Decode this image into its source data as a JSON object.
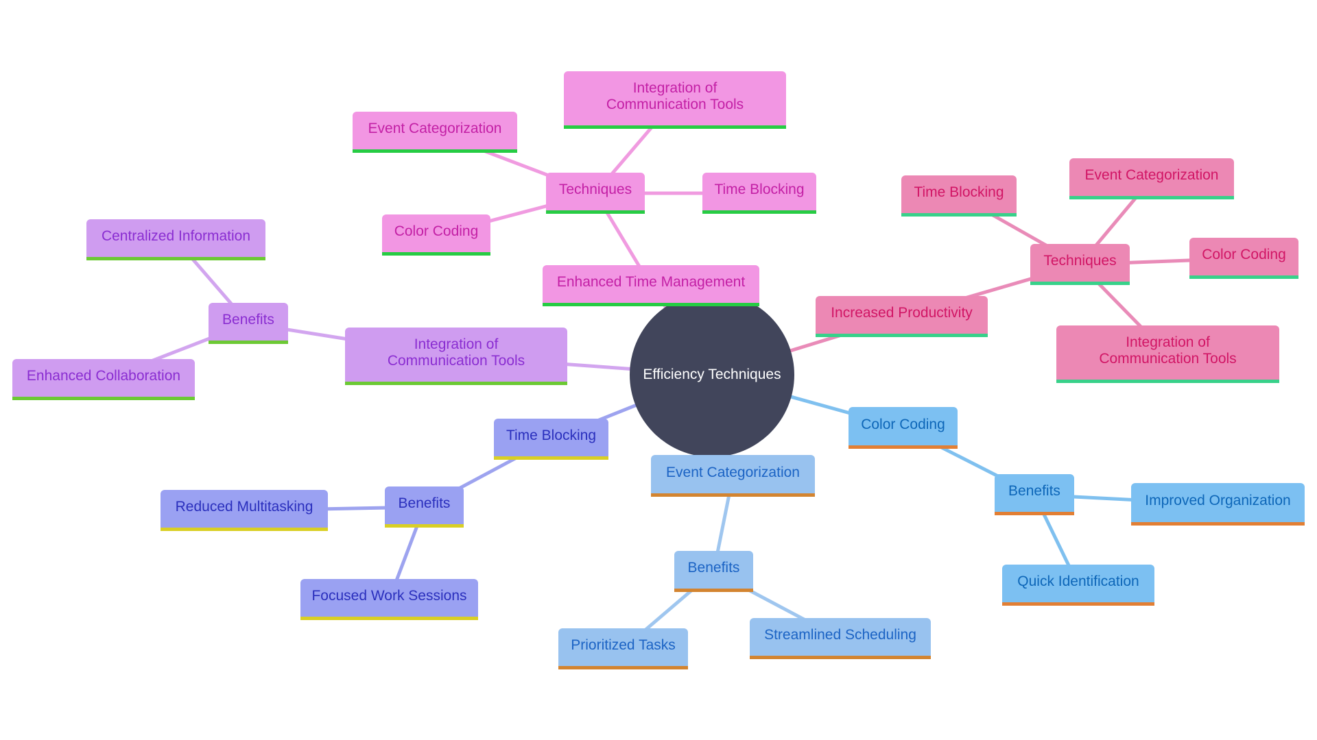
{
  "diagram": {
    "type": "mindmap",
    "root": {
      "label": "Efficiency Techniques",
      "color": "#41455b"
    },
    "branch_colors": {
      "enhanced_time_management": {
        "fill": "#f296e3",
        "text": "#c31fa5",
        "accent": "#26cc43",
        "edge": "#f09be0"
      },
      "increased_productivity": {
        "fill": "#ec88b4",
        "text": "#d11565",
        "accent": "#38d18a",
        "edge": "#e98bb8"
      },
      "integration_of_communication_tools": {
        "fill": "#cf9cf0",
        "text": "#8a2dd1",
        "accent": "#6cc934",
        "edge": "#d2a5ef"
      },
      "time_blocking": {
        "fill": "#9aa1f2",
        "text": "#2a2fbd",
        "accent": "#d9cf25",
        "edge": "#9da3ef"
      },
      "event_categorization": {
        "fill": "#98c2ef",
        "text": "#1b63c4",
        "accent": "#d38430",
        "edge": "#9fc6ef"
      },
      "color_coding": {
        "fill": "#7cc0f2",
        "text": "#0d66b8",
        "accent": "#e27f34",
        "edge": "#7fc0ef"
      }
    },
    "nodes": {
      "etm": "Enhanced Time Management",
      "etm_tech": "Techniques",
      "etm_tech_ec": "Event Categorization",
      "etm_tech_ict": "Integration of Communication Tools",
      "etm_tech_tb": "Time Blocking",
      "etm_tech_cc": "Color Coding",
      "ip": "Increased Productivity",
      "ip_tech": "Techniques",
      "ip_tech_tb": "Time Blocking",
      "ip_tech_ec": "Event Categorization",
      "ip_tech_cc": "Color Coding",
      "ip_tech_ict": "Integration of Communication Tools",
      "ict": "Integration of Communication Tools",
      "ict_ben": "Benefits",
      "ict_ben_ci": "Centralized Information",
      "ict_ben_ec": "Enhanced Collaboration",
      "tb": "Time Blocking",
      "tb_ben": "Benefits",
      "tb_ben_rm": "Reduced Multitasking",
      "tb_ben_fws": "Focused Work Sessions",
      "ec": "Event Categorization",
      "ec_ben": "Benefits",
      "ec_ben_pt": "Prioritized Tasks",
      "ec_ben_ss": "Streamlined Scheduling",
      "cc": "Color Coding",
      "cc_ben": "Benefits",
      "cc_ben_io": "Improved Organization",
      "cc_ben_qi": "Quick Identification"
    }
  }
}
